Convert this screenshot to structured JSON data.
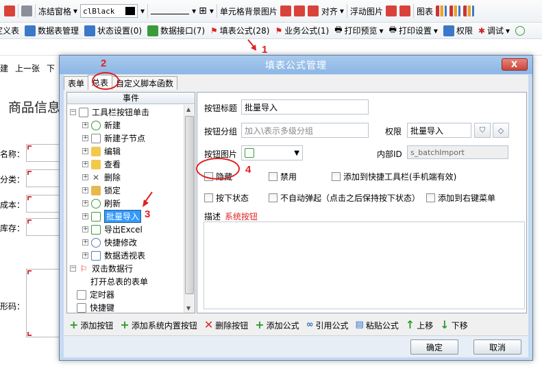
{
  "toolbar1": {
    "freeze": "冻结窗格",
    "color_value": "clBlack",
    "cell_bg": "单元格背景图片",
    "align": "对齐",
    "float_image": "浮动图片",
    "chart": "图表"
  },
  "toolbar2": {
    "items": [
      "定义表",
      "数据表管理",
      "状态设置(0)",
      "数据接口(7)",
      "填表公式(28)",
      "业务公式(1)",
      "打印预览",
      "打印设置",
      "权限",
      "调试"
    ]
  },
  "toolbar3": {
    "items": [
      "建",
      "上一张",
      "下"
    ]
  },
  "background_form": {
    "title": "商品信息",
    "labels": [
      "名称：",
      "分类：",
      "成本：",
      "库存：",
      "形码："
    ]
  },
  "annotations": [
    "1",
    "2",
    "3",
    "4"
  ],
  "dialog": {
    "title": "填表公式管理",
    "close_label": "X",
    "tabs": [
      "表单",
      "总表",
      "自定义脚本函数"
    ],
    "tree": {
      "header": "事件",
      "root": "工具栏按钮单击",
      "children": [
        "新建",
        "新建子节点",
        "编辑",
        "查看",
        "删除",
        "锁定",
        "刷新",
        "批量导入",
        "导出Excel",
        "快捷修改",
        "数据透视表"
      ],
      "root2": "双击数据行",
      "root2_child": "打开总表的表单",
      "timer": "定时器",
      "shortcut": "快捷键"
    },
    "props": {
      "title_label": "按钮标题",
      "title_value": "批量导入",
      "group_label": "按钮分组",
      "group_placeholder": "加入\\表示多级分组",
      "permission_label": "权限",
      "permission_value": "批量导入",
      "image_label": "按钮图片",
      "internal_id_label": "内部ID",
      "internal_id_value": "s_batchImport",
      "chk_hidden": "隐藏",
      "chk_disabled": "禁用",
      "chk_quick_toolbar": "添加到快捷工具栏(手机端有效)",
      "chk_pressed": "按下状态",
      "chk_no_popup": "不自动弹起（点击之后保持按下状态）",
      "chk_context_menu": "添加到右键菜单",
      "desc_label": "描述",
      "desc_value": "系统按钮"
    },
    "actions": [
      "添加按钮",
      "添加系统内置按钮",
      "删除按钮",
      "添加公式",
      "引用公式",
      "粘贴公式",
      "上移",
      "下移"
    ],
    "ok": "确定",
    "cancel": "取消"
  }
}
